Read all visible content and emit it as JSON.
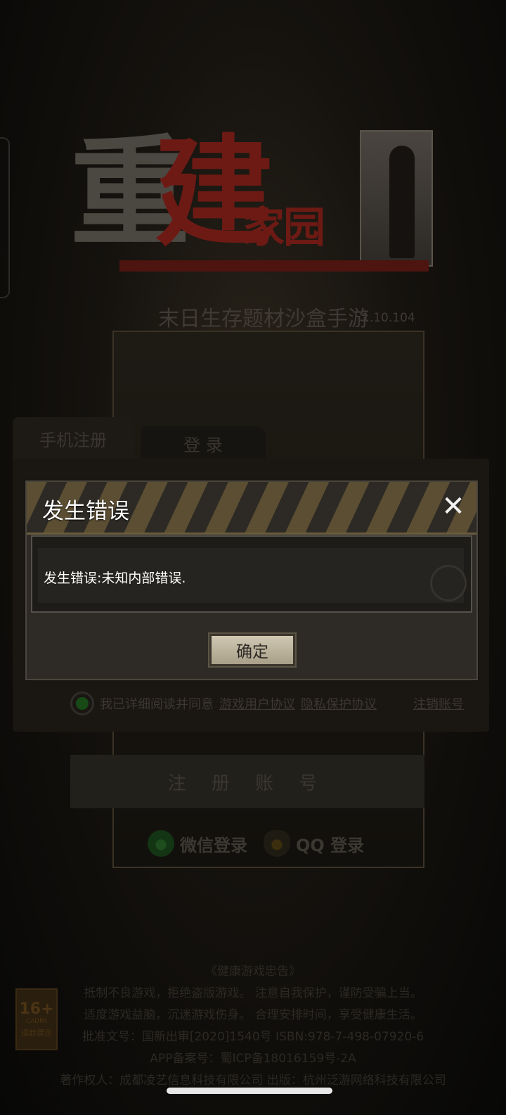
{
  "logo": {
    "char1": "重",
    "char2": "建",
    "chars_small": "家园"
  },
  "subtitle": "末日生存题材沙盒手游",
  "version": "1.10.104",
  "tabs": [
    {
      "label": "手机注册"
    },
    {
      "label": "登 录"
    }
  ],
  "agreement": {
    "text": "我已详细阅读并同意",
    "link_user": "游戏用户协议",
    "link_privacy": "隐私保护协议",
    "link_cancel": "注销账号"
  },
  "register_button": "注 册 账 号",
  "social": {
    "wechat": "微信登录",
    "qq": "QQ 登录"
  },
  "health_notice": {
    "title": "《健康游戏忠告》",
    "line1": "抵制不良游戏，拒绝盗版游戏。 注意自我保护，谨防受骗上当。",
    "line2": "适度游戏益脑，沉迷游戏伤身。 合理安排时间，享受健康生活。",
    "line3": "批准文号：国新出审[2020]1540号    ISBN:978-7-498-07920-6",
    "line4": "APP备案号：蜀ICP备18016159号-2A",
    "line5": "著作权人：成都凌艺信息科技有限公司 出版：杭州泛游网络科技有限公司"
  },
  "age_badge": {
    "number": "16+",
    "sub": "CADPA",
    "tip": "适龄提示"
  },
  "dialog": {
    "title": "发生错误",
    "close_symbol": "✕",
    "message": "发生错误:未知内部错误.",
    "ok_label": "确定"
  }
}
